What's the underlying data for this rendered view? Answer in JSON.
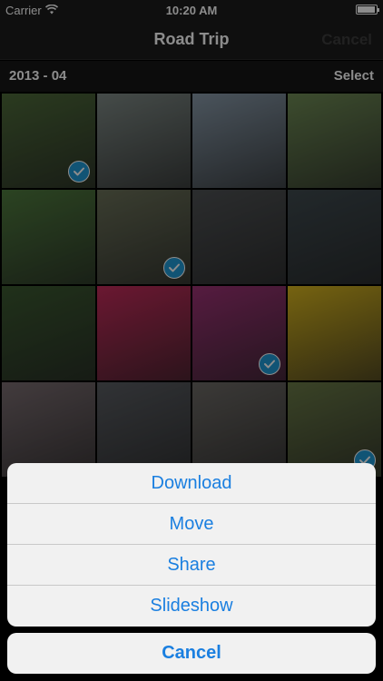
{
  "status_bar": {
    "carrier": "Carrier",
    "time": "10:20 AM",
    "icons": [
      "wifi-icon",
      "battery-icon"
    ],
    "battery_level": 0.95
  },
  "nav": {
    "title": "Road Trip",
    "cancel_label": "Cancel"
  },
  "section": {
    "date": "2013 - 04",
    "select_label": "Select"
  },
  "photos": [
    {
      "tone": "#4e6b3a",
      "selected": true
    },
    {
      "tone": "#7f8a86",
      "selected": false
    },
    {
      "tone": "#8899a8",
      "selected": false
    },
    {
      "tone": "#6f8b55",
      "selected": false
    },
    {
      "tone": "#4f7b3e",
      "selected": false
    },
    {
      "tone": "#6b7159",
      "selected": true
    },
    {
      "tone": "#4f5254",
      "selected": false
    },
    {
      "tone": "#3f4a4f",
      "selected": false
    },
    {
      "tone": "#3c5a31",
      "selected": false
    },
    {
      "tone": "#c32c5b",
      "selected": false
    },
    {
      "tone": "#9d3375",
      "selected": true
    },
    {
      "tone": "#d7b51f",
      "selected": false
    },
    {
      "tone": "#7a6d71",
      "selected": false
    },
    {
      "tone": "#5a5d62",
      "selected": false
    },
    {
      "tone": "#6d6a66",
      "selected": false
    },
    {
      "tone": "#6a7a47",
      "selected": true
    }
  ],
  "action_sheet": {
    "items": [
      "Download",
      "Move",
      "Share",
      "Slideshow"
    ],
    "cancel_label": "Cancel"
  },
  "colors": {
    "accent": "#1a7fe0",
    "check": "#1f9ad6"
  }
}
